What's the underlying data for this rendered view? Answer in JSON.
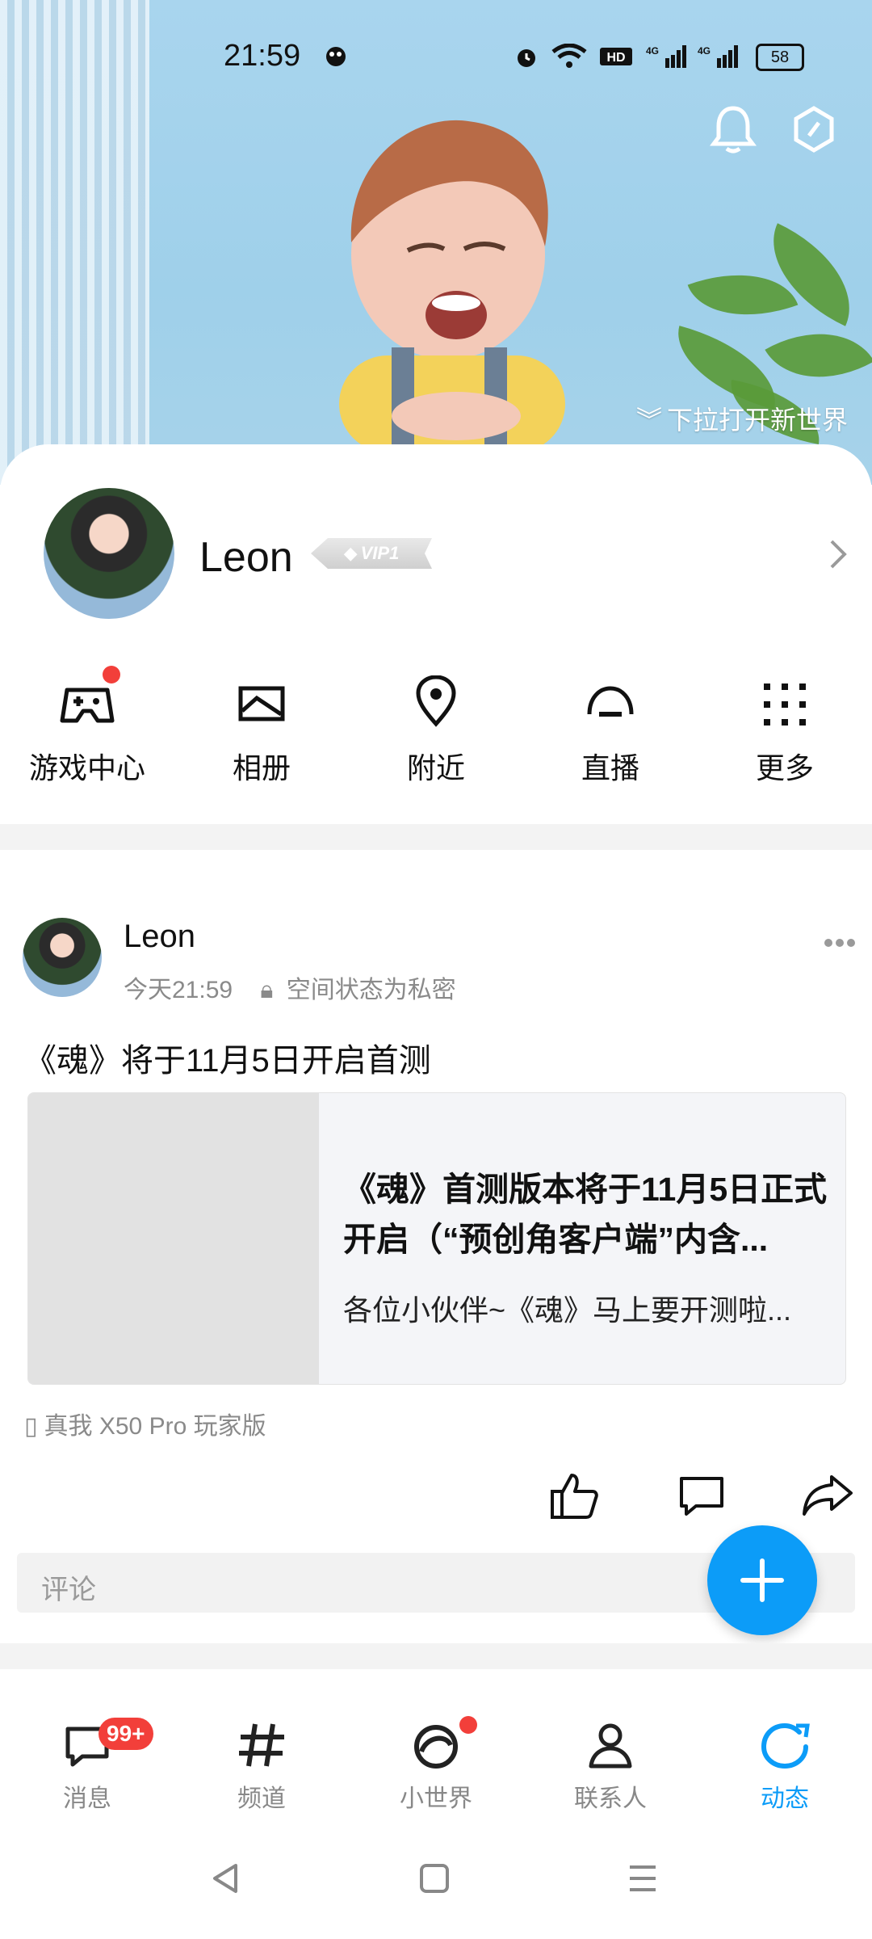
{
  "status_bar": {
    "time": "21:59",
    "battery": "58"
  },
  "hero": {
    "caption": "下拉打开新世界"
  },
  "profile": {
    "name": "Leon",
    "vip_label": "VIP1"
  },
  "features": [
    {
      "label": "游戏中心",
      "icon": "gamepad-icon"
    },
    {
      "label": "相册",
      "icon": "album-icon"
    },
    {
      "label": "附近",
      "icon": "location-pin-icon"
    },
    {
      "label": "直播",
      "icon": "live-icon"
    },
    {
      "label": "更多",
      "icon": "more-grid-icon"
    }
  ],
  "post": {
    "author": "Leon",
    "time": "今天21:59",
    "privacy": "空间状态为私密",
    "text": "《魂》将于11月5日开启首测",
    "card": {
      "title": "《魂》首测版本将于11月5日正式开启（“预创角客户端”内含...",
      "description": "各位小伙伴~《魂》马上要开测啦..."
    },
    "device": "真我 X50 Pro 玩家版",
    "comment_placeholder": "评论"
  },
  "bottom_nav": [
    {
      "label": "消息",
      "badge": "99+"
    },
    {
      "label": "频道"
    },
    {
      "label": "小世界"
    },
    {
      "label": "联系人"
    },
    {
      "label": "动态",
      "active": true
    }
  ],
  "colors": {
    "accent": "#0c9cf8",
    "badge": "#f23f3a"
  }
}
